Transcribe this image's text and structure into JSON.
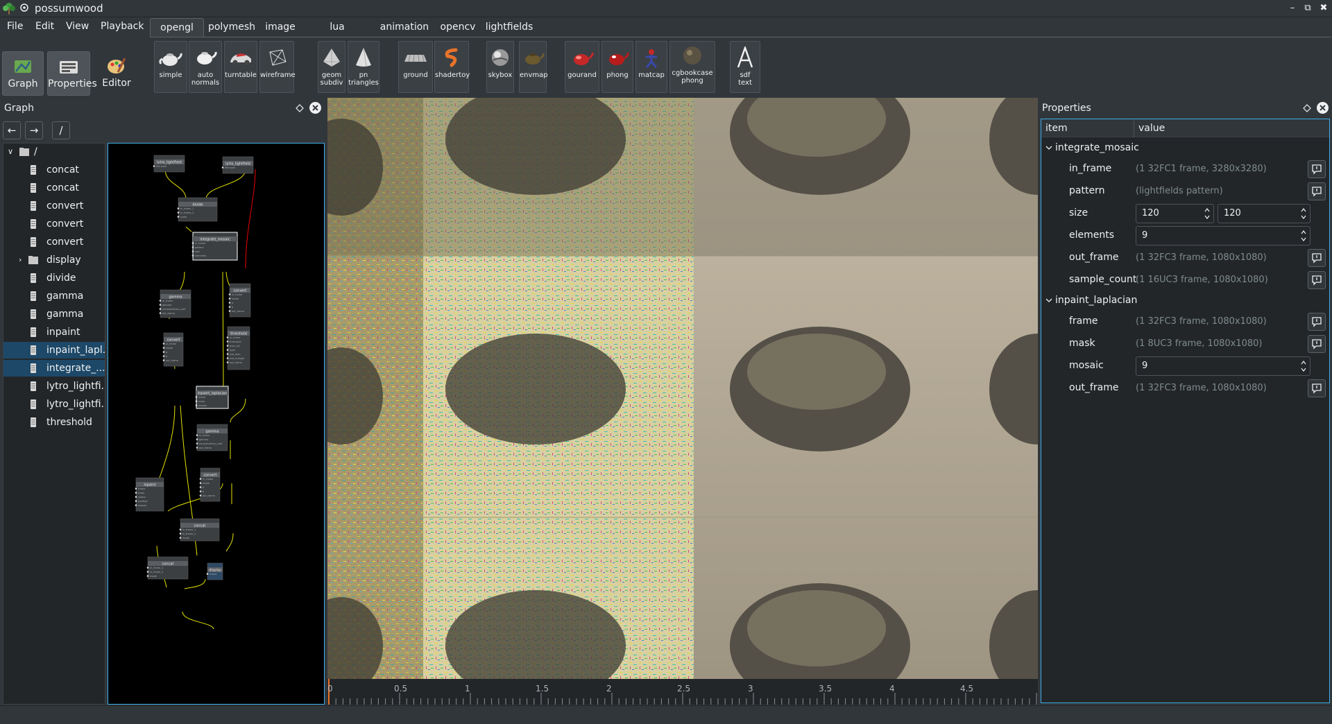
{
  "window": {
    "title": "possumwood"
  },
  "menu": [
    "File",
    "Edit",
    "View",
    "Playback"
  ],
  "bigtools": [
    {
      "label": "Graph",
      "icon": "graph-icon",
      "active": true
    },
    {
      "label": "Properties",
      "icon": "properties-icon",
      "active": true
    },
    {
      "label": "Editor",
      "icon": "editor-icon",
      "active": false
    }
  ],
  "tabs": [
    "opengl",
    "polymesh",
    "image",
    "lua",
    "animation",
    "opencv",
    "lightfields"
  ],
  "active_tab": "opengl",
  "shelf": [
    {
      "label": "simple",
      "icon": "teapot-icon"
    },
    {
      "label": "auto\nnormals",
      "icon": "teapot-icon"
    },
    {
      "label": "turntable",
      "icon": "car-icon"
    },
    {
      "label": "wireframe",
      "icon": "wireframe-icon"
    },
    {
      "label": "geom\nsubdiv",
      "icon": "geom-subdiv-icon"
    },
    {
      "label": "pn\ntriangles",
      "icon": "cone-icon"
    },
    {
      "label": "ground",
      "icon": "ground-icon"
    },
    {
      "label": "shadertoy",
      "icon": "shadertoy-icon"
    },
    {
      "label": "skybox",
      "icon": "skybox-icon"
    },
    {
      "label": "envmap",
      "icon": "envmap-icon"
    },
    {
      "label": "gourand",
      "icon": "red-teapot-icon"
    },
    {
      "label": "phong",
      "icon": "red-teapot-icon"
    },
    {
      "label": "matcap",
      "icon": "matcap-icon"
    },
    {
      "label": "cgbookcase\nphong",
      "icon": "cgbookcase-icon"
    },
    {
      "label": "sdf\ntext",
      "icon": "sdf-text-icon"
    }
  ],
  "graph": {
    "title": "Graph",
    "path": "/",
    "tree_root": "/",
    "tree": [
      {
        "label": "concat",
        "type": "node"
      },
      {
        "label": "concat",
        "type": "node"
      },
      {
        "label": "convert",
        "type": "node"
      },
      {
        "label": "convert",
        "type": "node"
      },
      {
        "label": "convert",
        "type": "node"
      },
      {
        "label": "display",
        "type": "folder"
      },
      {
        "label": "divide",
        "type": "node"
      },
      {
        "label": "gamma",
        "type": "node"
      },
      {
        "label": "gamma",
        "type": "node"
      },
      {
        "label": "inpaint",
        "type": "node"
      },
      {
        "label": "inpaint_lapl...",
        "type": "node",
        "selected": true
      },
      {
        "label": "integrate_...",
        "type": "node",
        "selected": true
      },
      {
        "label": "lytro_lightfi...",
        "type": "node"
      },
      {
        "label": "lytro_lightfi...",
        "type": "node"
      },
      {
        "label": "threshold",
        "type": "node"
      }
    ],
    "nodes": [
      {
        "name": "lytro_lightfield",
        "ports": [
          "filename",
          "frame",
          "pattern"
        ]
      },
      {
        "name": "lytro_lightfield",
        "ports": [
          "filename",
          "frame",
          "pattern"
        ]
      },
      {
        "name": "divide",
        "ports": [
          "in_frame_1",
          "in_frame_2",
          "scale",
          "out_frame"
        ]
      },
      {
        "name": "integrate_mosaic",
        "ports": [
          "in_frame",
          "pattern",
          "size",
          "elements",
          "out_frame",
          "sample_count"
        ]
      },
      {
        "name": "gamma",
        "ports": [
          "in_frame",
          "gamma",
          "normalization_coef",
          "out_frame"
        ]
      },
      {
        "name": "convert",
        "ports": [
          "in_frame",
          "mode",
          "a",
          "b",
          "out_frame"
        ]
      },
      {
        "name": "convert",
        "ports": [
          "in_frame",
          "mode",
          "a",
          "b",
          "out_frame"
        ]
      },
      {
        "name": "threshold",
        "ports": [
          "in_frame",
          "threshold",
          "max_val",
          "type",
          "use_otsu",
          "use_triangle",
          "out_frame"
        ]
      },
      {
        "name": "inpaint_laplacian",
        "ports": [
          "frame",
          "mask",
          "mosaic",
          "out_frame"
        ]
      },
      {
        "name": "gamma",
        "ports": [
          "in_frame",
          "gamma",
          "normalization_coef",
          "out_frame"
        ]
      },
      {
        "name": "convert",
        "ports": [
          "in_frame",
          "mode",
          "a",
          "b",
          "out_frame"
        ]
      },
      {
        "name": "inpaint",
        "ports": [
          "frame",
          "mask",
          "radius",
          "method",
          "mosaic",
          "out_frame"
        ]
      },
      {
        "name": "concat",
        "ports": [
          "in_frame_1",
          "in_frame_2",
          "mode",
          "out_frame"
        ]
      },
      {
        "name": "concat",
        "ports": [
          "in_frame_1",
          "in_frame_2",
          "mode",
          "out_frame"
        ]
      },
      {
        "name": "display",
        "ports": [
          "frame",
          "zoom"
        ]
      }
    ]
  },
  "timeline": {
    "ticks": [
      "0",
      "0.5",
      "1",
      "1.5",
      "2",
      "2.5",
      "3",
      "3.5",
      "4",
      "4.5"
    ]
  },
  "properties": {
    "title": "Properties",
    "col_item": "item",
    "col_value": "value",
    "groups": [
      {
        "name": "integrate_mosaic",
        "rows": [
          {
            "key": "in_frame",
            "value": "(1 32FC1 frame, 3280x3280)",
            "kind": "ro",
            "button": true
          },
          {
            "key": "pattern",
            "value": "(lightfields pattern)",
            "kind": "ro",
            "button": true
          },
          {
            "key": "size",
            "value": "120",
            "value2": "120",
            "kind": "spin2"
          },
          {
            "key": "elements",
            "value": "9",
            "kind": "spin"
          },
          {
            "key": "out_frame",
            "value": "(1 32FC3 frame, 1080x1080)",
            "kind": "ro",
            "button": true
          },
          {
            "key": "sample_count",
            "value": "(1 16UC3 frame, 1080x1080)",
            "kind": "ro",
            "button": true
          }
        ]
      },
      {
        "name": "inpaint_laplacian",
        "rows": [
          {
            "key": "frame",
            "value": "(1 32FC3 frame, 1080x1080)",
            "kind": "ro",
            "button": true
          },
          {
            "key": "mask",
            "value": "(1 8UC3 frame, 1080x1080)",
            "kind": "ro",
            "button": true
          },
          {
            "key": "mosaic",
            "value": "9",
            "kind": "spin"
          },
          {
            "key": "out_frame",
            "value": "(1 32FC3 frame, 1080x1080)",
            "kind": "ro",
            "button": true
          }
        ]
      }
    ]
  }
}
